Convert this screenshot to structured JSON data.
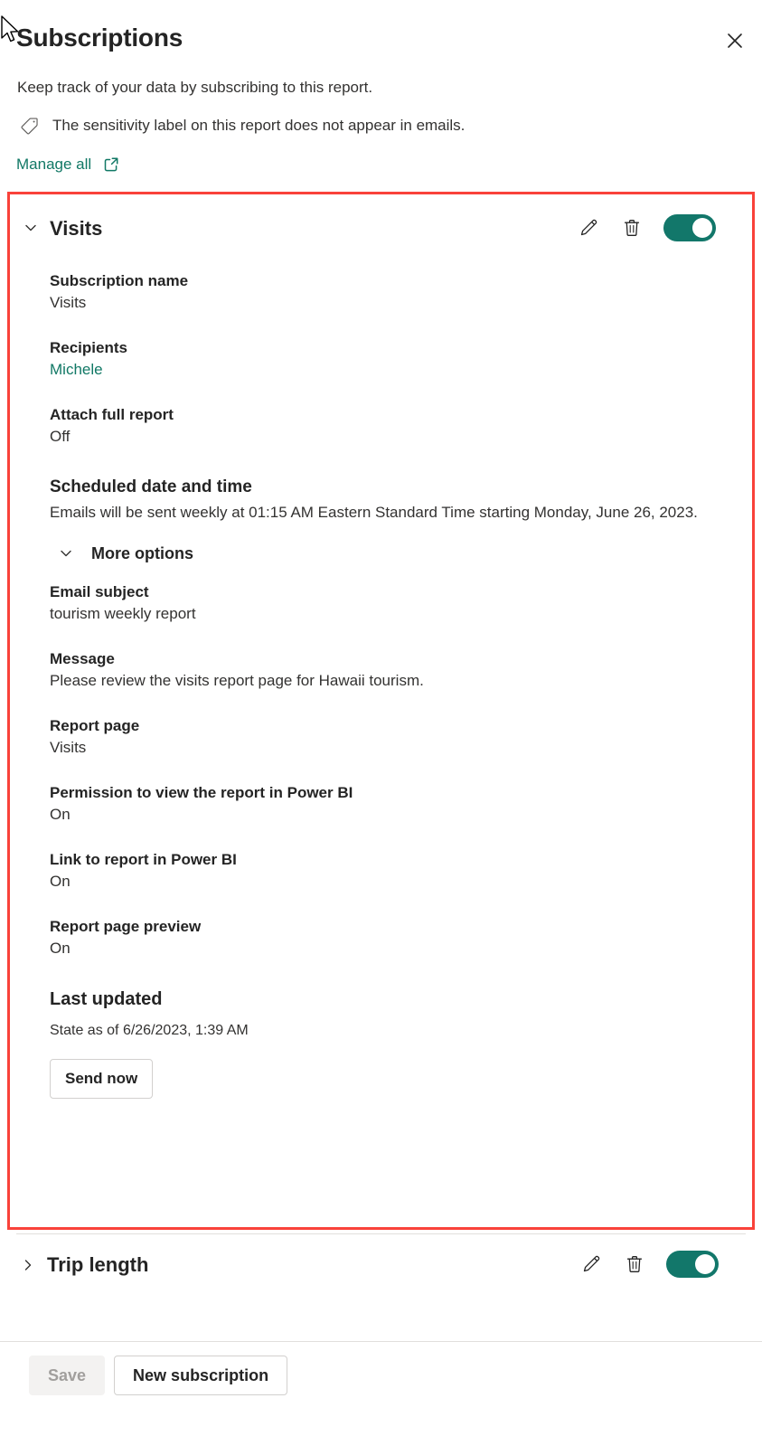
{
  "header": {
    "title": "Subscriptions",
    "close_label": "Close",
    "subtitle": "Keep track of your data by subscribing to this report.",
    "sensitivity_notice": "The sensitivity label on this report does not appear in emails.",
    "manage_all_label": "Manage all"
  },
  "subscriptions": [
    {
      "title": "Visits",
      "expanded": true,
      "toggle_state": "on",
      "fields": [
        {
          "label": "Subscription name",
          "value": "Visits"
        },
        {
          "label": "Recipients",
          "value": "Michele",
          "is_link": true
        },
        {
          "label": "Attach full report",
          "value": "Off"
        }
      ],
      "schedule": {
        "label": "Scheduled date and time",
        "description": "Emails will be sent weekly at 01:15 AM Eastern Standard Time starting Monday, June 26, 2023."
      },
      "more_options": {
        "label": "More options",
        "expanded": true,
        "fields": [
          {
            "label": "Email subject",
            "value": "tourism weekly report"
          },
          {
            "label": "Message",
            "value": "Please review the visits report page for Hawaii tourism."
          },
          {
            "label": "Report page",
            "value": "Visits"
          },
          {
            "label": "Permission to view the report in Power BI",
            "value": "On"
          },
          {
            "label": "Link to report in Power BI",
            "value": "On"
          },
          {
            "label": "Report page preview",
            "value": "On"
          }
        ]
      },
      "last_updated": {
        "label": "Last updated",
        "value": "State as of 6/26/2023, 1:39 AM"
      },
      "send_now_label": "Send now"
    },
    {
      "title": "Trip length",
      "expanded": false,
      "toggle_state": "on"
    }
  ],
  "footer": {
    "save_label": "Save",
    "save_disabled": true,
    "new_subscription_label": "New subscription"
  },
  "colors": {
    "accent_teal": "#117865",
    "toggle_on": "#12776a",
    "highlight_red": "#f9423a",
    "text_primary": "#242424",
    "text_secondary": "#333231",
    "disabled_text": "#a19f9d",
    "disabled_bg": "#f3f2f1",
    "border": "#d2d0ce"
  }
}
